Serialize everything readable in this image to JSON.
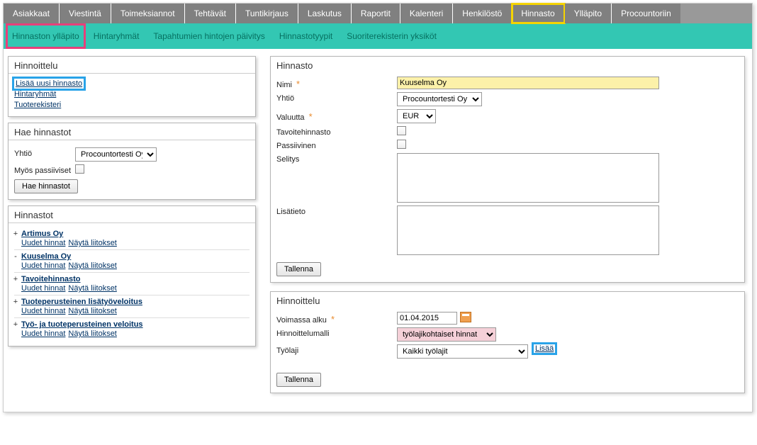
{
  "main_tabs": [
    "Asiakkaat",
    "Viestintä",
    "Toimeksiannot",
    "Tehtävät",
    "Tuntikirjaus",
    "Laskutus",
    "Raportit",
    "Kalenteri",
    "Henkilöstö",
    "Hinnasto",
    "Ylläpito",
    "Procountoriin"
  ],
  "main_tab_active_index": 9,
  "sub_tabs": [
    "Hinnaston ylläpito",
    "Hintaryhmät",
    "Tapahtumien hintojen päivitys",
    "Hinnastotyypit",
    "Suoriterekisterin yksiköt"
  ],
  "sub_tab_active_index": 0,
  "left": {
    "hinnoittelu_title": "Hinnoittelu",
    "links": {
      "lisaa_uusi": "Lisää uusi hinnasto",
      "hintaryhmat": "Hintaryhmät",
      "tuoterekisteri": "Tuoterekisteri"
    },
    "hae_title": "Hae hinnastot",
    "hae": {
      "yhtio_label": "Yhtiö",
      "yhtio_value": "Procountortesti Oy",
      "myos_passiiviset_label": "Myös passiiviset",
      "btn": "Hae hinnastot"
    },
    "hinnastot_title": "Hinnastot",
    "hinnastot": [
      {
        "exp": "+",
        "name": "Artimus Oy",
        "a": "Uudet hinnat",
        "b": "Näytä liitokset"
      },
      {
        "exp": "-",
        "name": "Kuuselma Oy",
        "a": "Uudet hinnat",
        "b": "Näytä liitokset"
      },
      {
        "exp": "+",
        "name": "Tavoitehinnasto",
        "a": "Uudet hinnat",
        "b": "Näytä liitokset"
      },
      {
        "exp": "+",
        "name": "Tuoteperusteinen lisätyöveloitus",
        "a": "Uudet hinnat",
        "b": "Näytä liitokset"
      },
      {
        "exp": "+",
        "name": "Työ- ja tuoteperusteinen veloitus",
        "a": "Uudet hinnat",
        "b": "Näytä liitokset"
      }
    ]
  },
  "right": {
    "hinnasto_title": "Hinnasto",
    "nimi_label": "Nimi",
    "nimi_value": "Kuuselma Oy",
    "yhtio_label": "Yhtiö",
    "yhtio_value": "Procountortesti Oy",
    "valuutta_label": "Valuutta",
    "valuutta_value": "EUR",
    "tavoite_label": "Tavoitehinnasto",
    "passiivinen_label": "Passiivinen",
    "selitys_label": "Selitys",
    "lisatieto_label": "Lisätieto",
    "tallenna": "Tallenna",
    "hinnoittelu_title": "Hinnoittelu",
    "voimassa_label": "Voimassa alku",
    "voimassa_value": "01.04.2015",
    "malli_label": "Hinnoittelumalli",
    "malli_value": "työlajikohtaiset hinnat",
    "tyolaji_label": "Työlaji",
    "tyolaji_value": "Kaikki työlajit",
    "lisaa": "Lisää"
  }
}
